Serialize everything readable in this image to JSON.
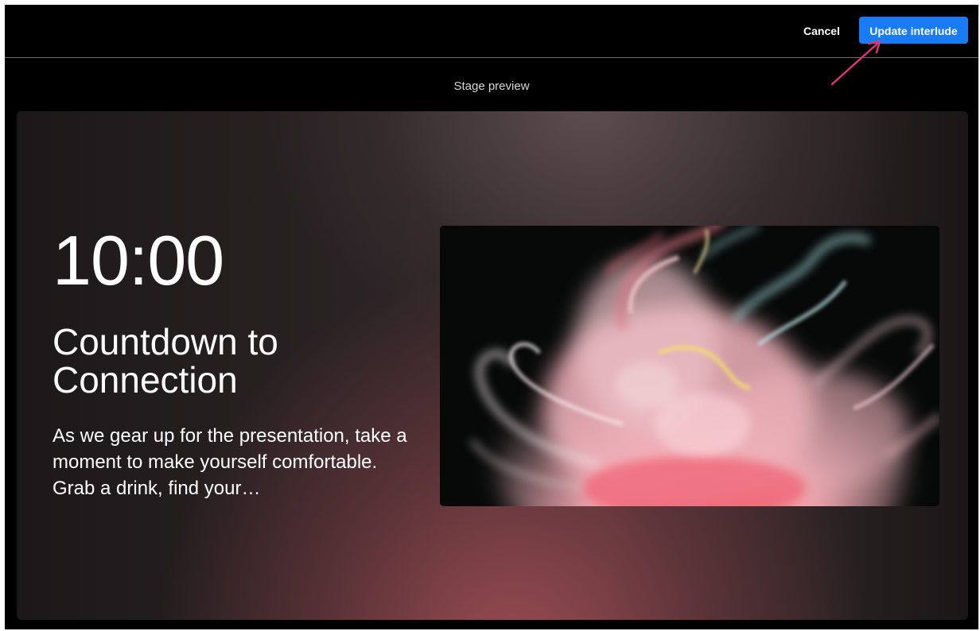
{
  "toolbar": {
    "cancel_label": "Cancel",
    "update_label": "Update interlude"
  },
  "preview": {
    "label": "Stage preview"
  },
  "stage": {
    "timer": "10:00",
    "title": "Countdown to Connection",
    "description": "As we gear up for the presentation, take a moment to make yourself comfortable. Grab a drink, find your…"
  },
  "colors": {
    "accent": "#1a7cf5",
    "annotation_arrow": "#e0347a",
    "background": "#000000"
  }
}
